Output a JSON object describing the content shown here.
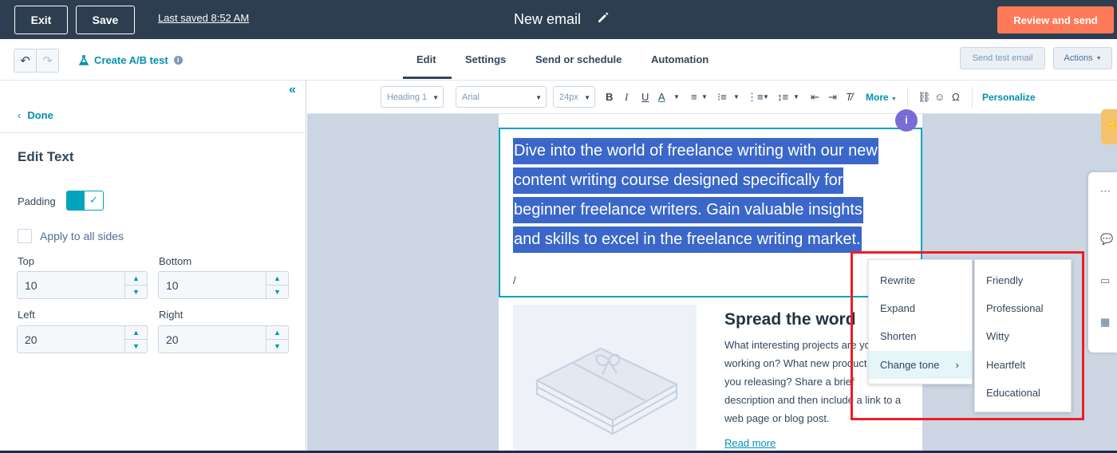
{
  "header": {
    "exit_label": "Exit",
    "save_label": "Save",
    "last_saved": "Last saved 8:52 AM",
    "email_title": "New email",
    "review_label": "Review and send"
  },
  "subbar": {
    "ab_test_label": "Create A/B test",
    "tabs": [
      {
        "label": "Edit",
        "active": true
      },
      {
        "label": "Settings"
      },
      {
        "label": "Send or schedule"
      },
      {
        "label": "Automation"
      }
    ],
    "send_test_label": "Send test email",
    "actions_label": "Actions"
  },
  "left_panel": {
    "done_label": "Done",
    "title": "Edit Text",
    "padding_label": "Padding",
    "padding_enabled": true,
    "apply_all_label": "Apply to all sides",
    "apply_all_checked": false,
    "fields": {
      "top": {
        "label": "Top",
        "value": "10"
      },
      "bottom": {
        "label": "Bottom",
        "value": "10"
      },
      "left": {
        "label": "Left",
        "value": "20"
      },
      "right": {
        "label": "Right",
        "value": "20"
      }
    }
  },
  "toolbar": {
    "style_select": "Heading 1",
    "font_select": "Arial",
    "size_select": "24px",
    "more_label": "More",
    "personalize_label": "Personalize"
  },
  "email": {
    "selected_lines": [
      "Dive into the world of freelance writing with our new",
      "content writing course designed specifically for",
      "beginner freelance writers. Gain valuable insights",
      "and skills to excel in the freelance writing market."
    ],
    "slash_text": "/",
    "badge_text": "i",
    "spread_title": "Spread the word",
    "spread_lines": [
      "What interesting projects are yo",
      "working on? What new product",
      "you releasing? Share a brief",
      "description and then include a link to a",
      "web page or blog post."
    ],
    "read_more": "Read more"
  },
  "ai_menu": {
    "actions": [
      "Rewrite",
      "Expand",
      "Shorten",
      "Change tone"
    ],
    "active_action": "Change tone",
    "tones": [
      "Friendly",
      "Professional",
      "Witty",
      "Heartfelt",
      "Educational"
    ]
  },
  "colors": {
    "topbar": "#2d3e50",
    "accent_orange": "#ff7a59",
    "teal": "#00a4bd",
    "selection": "#3a67c9",
    "highlight_frame": "#ee1c25"
  },
  "icons": {
    "edit_title": "pencil-icon",
    "undo": "undo-icon",
    "redo": "redo-icon",
    "ab_test": "flask-icon",
    "collapse": "double-chevron-left-icon"
  }
}
